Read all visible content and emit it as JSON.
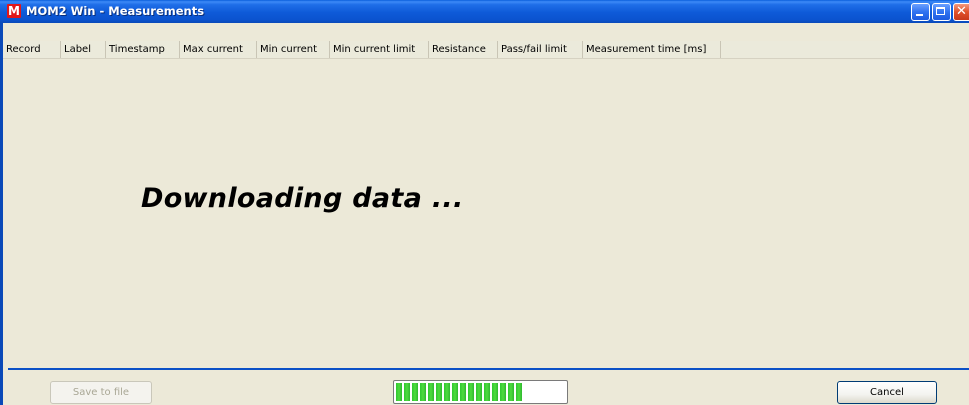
{
  "window": {
    "title": "MOM2 Win - Measurements",
    "icon_letter": "M",
    "icon": "app-logo-icon",
    "controls": [
      "minimize-icon",
      "maximize-icon",
      "close-icon"
    ],
    "accent_color": "#0b53cf"
  },
  "table": {
    "columns": [
      "Record",
      "Label",
      "Timestamp",
      "Max current",
      "Min current",
      "Min current limit",
      "Resistance",
      "Pass/fail limit",
      "Measurement time [ms]"
    ]
  },
  "status": {
    "message": "Downloading data ..."
  },
  "footer": {
    "save_label": "Save to file",
    "save_enabled": false,
    "cancel_label": "Cancel",
    "progress_percent": 76,
    "progress_color": "#3ccd34"
  }
}
